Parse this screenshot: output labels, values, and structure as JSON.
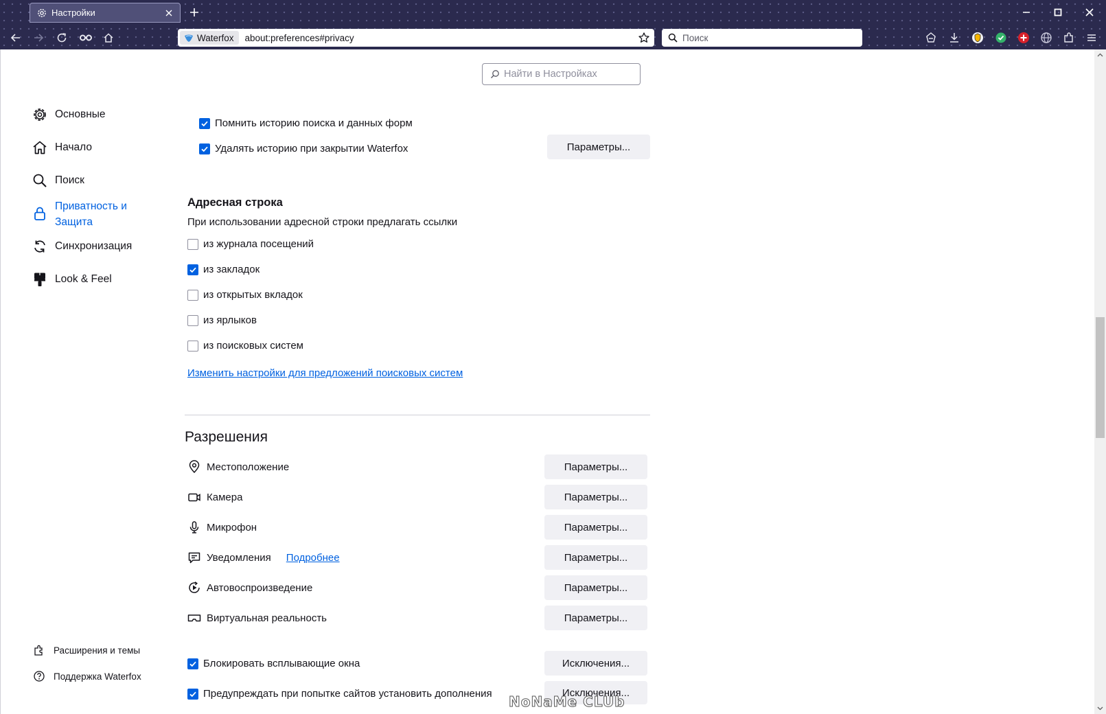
{
  "tab": {
    "title": "Настройки"
  },
  "toolbar": {
    "identity_label": "Waterfox",
    "url": "about:preferences#privacy",
    "search_placeholder": "Поиск"
  },
  "find_in_settings": {
    "placeholder": "Найти в Настройках"
  },
  "sidebar": {
    "items": [
      {
        "label": "Основные",
        "icon": "gear-icon"
      },
      {
        "label": "Начало",
        "icon": "home-icon"
      },
      {
        "label": "Поиск",
        "icon": "search-icon"
      },
      {
        "label_line1": "Приватность и",
        "label_line2": "Защита",
        "icon": "lock-icon",
        "selected": true
      },
      {
        "label": "Синхронизация",
        "icon": "sync-icon"
      },
      {
        "label": "Look & Feel",
        "icon": "paintbrush-icon"
      }
    ],
    "footer": [
      {
        "label": "Расширения и темы",
        "icon": "puzzle-icon"
      },
      {
        "label": "Поддержка Waterfox",
        "icon": "help-icon"
      }
    ]
  },
  "history": {
    "remember_search": {
      "label": "Помнить историю поиска и данных форм",
      "checked": true
    },
    "clear_on_close": {
      "label": "Удалять историю при закрытии Waterfox",
      "checked": true
    },
    "settings_button": "Параметры..."
  },
  "address_bar": {
    "heading": "Адресная строка",
    "description": "При использовании адресной строки предлагать ссылки",
    "options": [
      {
        "label": "из журнала посещений",
        "checked": false
      },
      {
        "label": "из закладок",
        "checked": true
      },
      {
        "label": "из открытых вкладок",
        "checked": false
      },
      {
        "label": "из ярлыков",
        "checked": false
      },
      {
        "label": "из поисковых систем",
        "checked": false
      }
    ],
    "link": "Изменить настройки для предложений поисковых систем"
  },
  "permissions": {
    "heading": "Разрешения",
    "items": [
      {
        "label": "Местоположение",
        "icon": "location-icon",
        "button": "Параметры..."
      },
      {
        "label": "Камера",
        "icon": "camera-icon",
        "button": "Параметры..."
      },
      {
        "label": "Микрофон",
        "icon": "microphone-icon",
        "button": "Параметры..."
      },
      {
        "label": "Уведомления",
        "icon": "notification-icon",
        "button": "Параметры...",
        "learn_more": "Подробнее"
      },
      {
        "label": "Автовоспроизведение",
        "icon": "autoplay-icon",
        "button": "Параметры..."
      },
      {
        "label": "Виртуальная реальность",
        "icon": "vr-icon",
        "button": "Параметры..."
      }
    ],
    "block_popups": {
      "label": "Блокировать всплывающие окна",
      "checked": true,
      "button": "Исключения..."
    },
    "warn_addons": {
      "label": "Предупреждать при попытке сайтов установить дополнения",
      "checked": true,
      "button": "Исключения..."
    }
  },
  "watermark": "NoNaMe CLUb",
  "colors": {
    "accent": "#0061e0",
    "chrome": "#2b2a4e",
    "button_bg": "#f0f0f4"
  }
}
